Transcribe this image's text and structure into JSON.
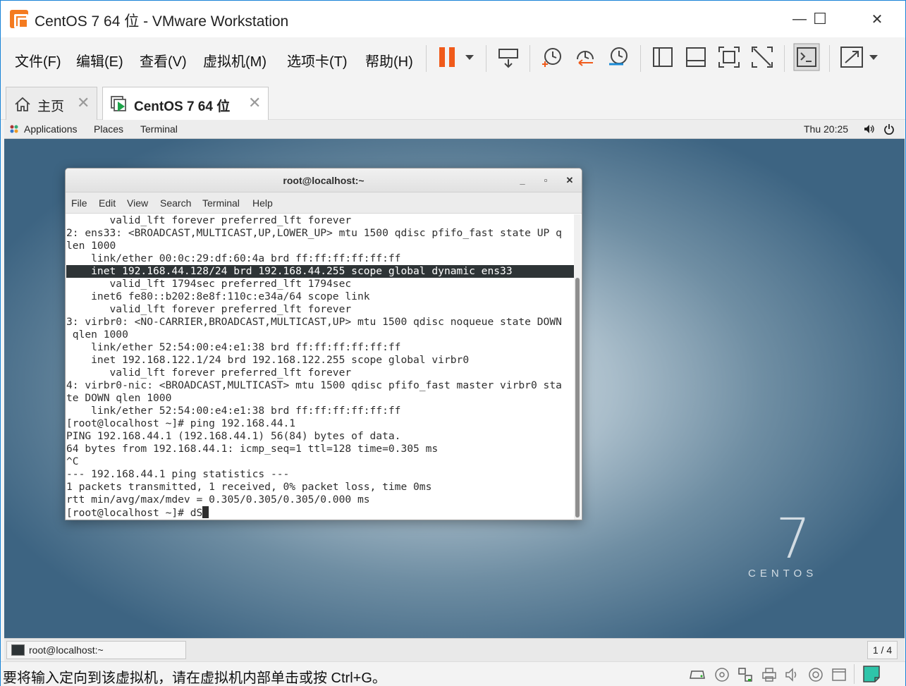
{
  "window": {
    "title": "CentOS 7 64 位 - VMware Workstation",
    "minimize": "—",
    "maximize": "☐",
    "close": "✕"
  },
  "menu": [
    "文件(F)",
    "编辑(E)",
    "查看(V)",
    "虚拟机(M)",
    "选项卡(T)",
    "帮助(H)"
  ],
  "tabs": [
    {
      "label": "主页",
      "close": "✕",
      "active": false
    },
    {
      "label": "CentOS 7 64 位",
      "close": "✕",
      "active": true
    }
  ],
  "gnome": {
    "applications": "Applications",
    "places": "Places",
    "terminal": "Terminal",
    "clock": "Thu 20:25"
  },
  "terminal": {
    "title": "root@localhost:~",
    "menu": [
      "File",
      "Edit",
      "View",
      "Search",
      "Terminal",
      "Help"
    ],
    "lines": [
      "       valid_lft forever preferred_lft forever",
      "2: ens33: <BROADCAST,MULTICAST,UP,LOWER_UP> mtu 1500 qdisc pfifo_fast state UP q",
      "len 1000",
      "    link/ether 00:0c:29:df:60:4a brd ff:ff:ff:ff:ff:ff",
      "    inet 192.168.44.128/24 brd 192.168.44.255 scope global dynamic ens33",
      "       valid_lft 1794sec preferred_lft 1794sec",
      "    inet6 fe80::b202:8e8f:110c:e34a/64 scope link",
      "       valid_lft forever preferred_lft forever",
      "3: virbr0: <NO-CARRIER,BROADCAST,MULTICAST,UP> mtu 1500 qdisc noqueue state DOWN",
      " qlen 1000",
      "    link/ether 52:54:00:e4:e1:38 brd ff:ff:ff:ff:ff:ff",
      "    inet 192.168.122.1/24 brd 192.168.122.255 scope global virbr0",
      "       valid_lft forever preferred_lft forever",
      "4: virbr0-nic: <BROADCAST,MULTICAST> mtu 1500 qdisc pfifo_fast master virbr0 sta",
      "te DOWN qlen 1000",
      "    link/ether 52:54:00:e4:e1:38 brd ff:ff:ff:ff:ff:ff",
      "[root@localhost ~]# ping 192.168.44.1",
      "PING 192.168.44.1 (192.168.44.1) 56(84) bytes of data.",
      "64 bytes from 192.168.44.1: icmp_seq=1 ttl=128 time=0.305 ms",
      "^C",
      "--- 192.168.44.1 ping statistics ---",
      "1 packets transmitted, 1 received, 0% packet loss, time 0ms",
      "rtt min/avg/max/mdev = 0.305/0.305/0.305/0.000 ms",
      "[root@localhost ~]# dS"
    ],
    "highlighted_line": 4
  },
  "desktop": {
    "logo_number": "7",
    "logo_word": "CENTOS"
  },
  "taskbar": {
    "item": "root@localhost:~",
    "workspace": "1 / 4"
  },
  "status": {
    "text": "要将输入定向到该虚拟机，请在虚拟机内部单击或按 Ctrl+G。"
  },
  "colors": {
    "accent": "#f47b20",
    "border": "#1883d7",
    "highlight": "#2e3436"
  }
}
